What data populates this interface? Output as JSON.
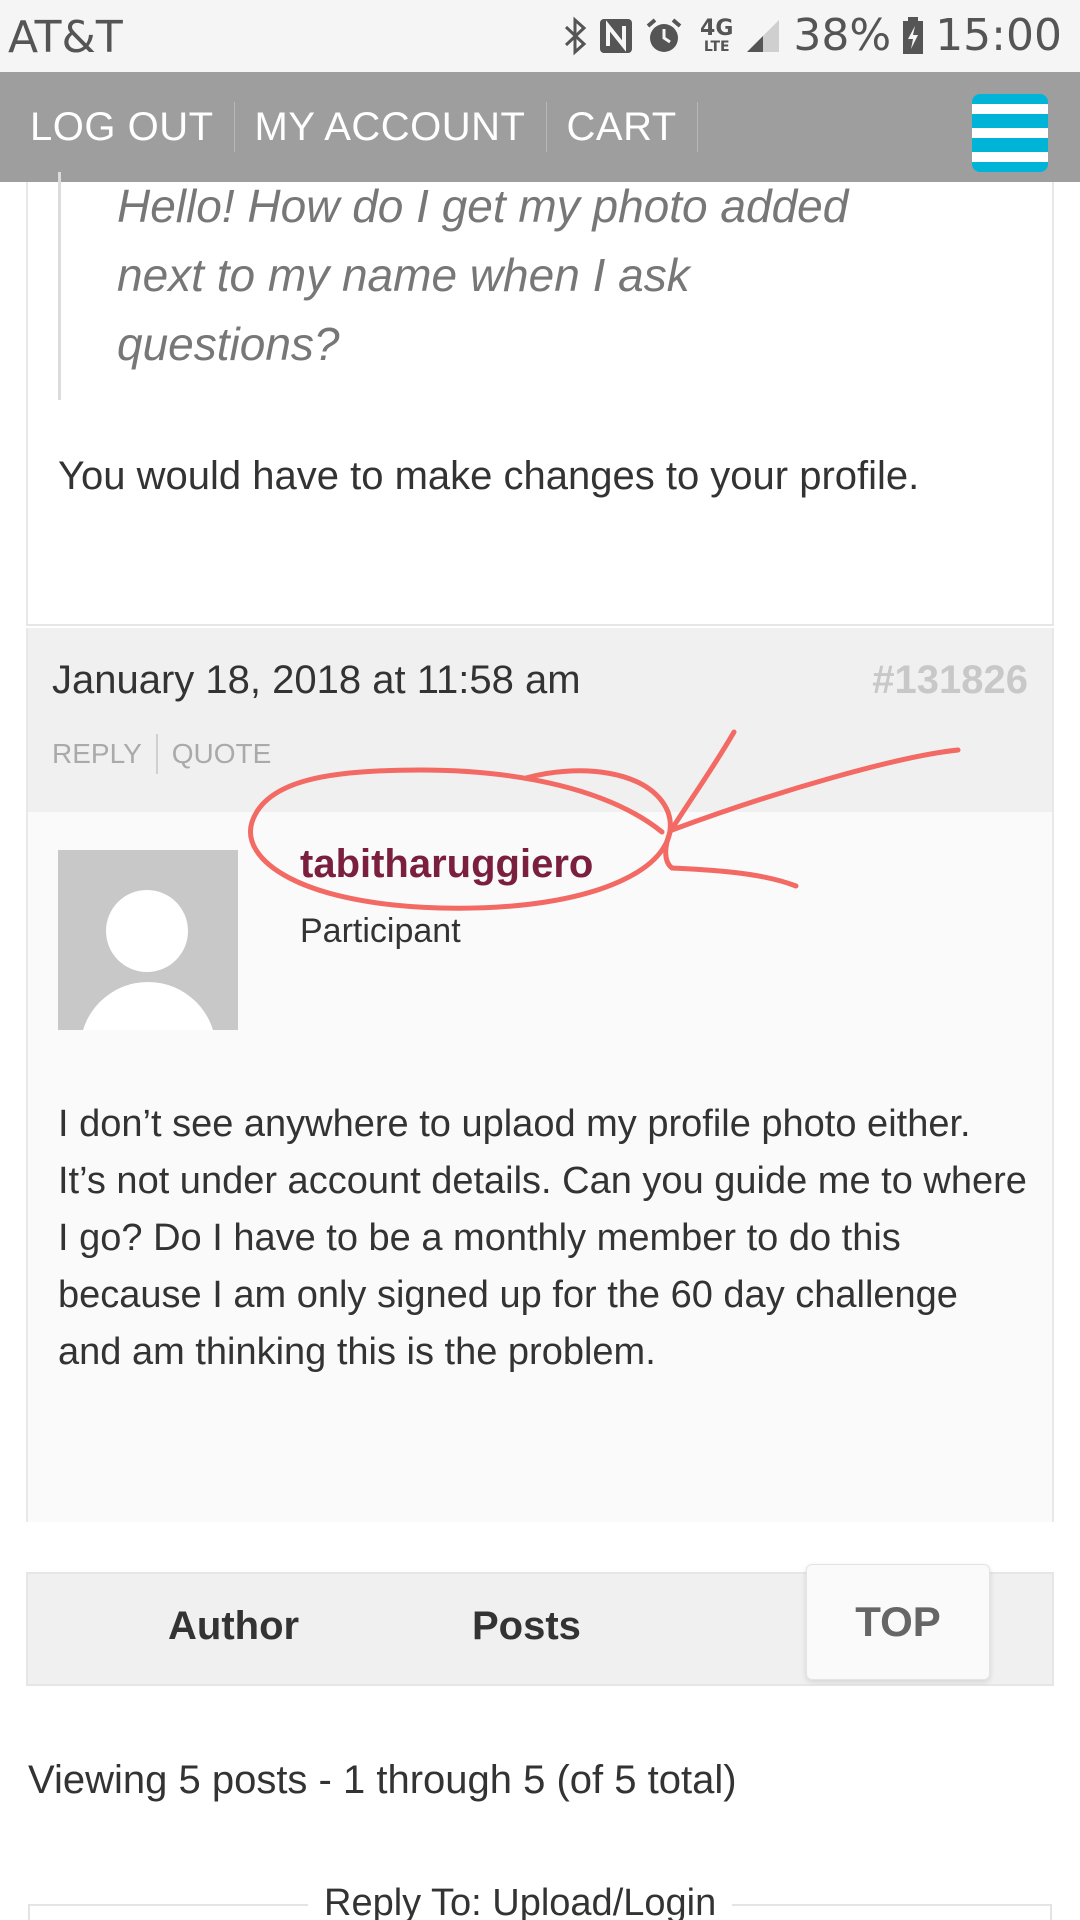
{
  "status_bar": {
    "carrier": "AT&T",
    "network": "4G",
    "network_sub": "LTE",
    "battery": "38%",
    "time": "15:00",
    "icons": [
      "bluetooth-icon",
      "nfc-icon",
      "alarm-icon",
      "signal-icon",
      "battery-charging-icon"
    ]
  },
  "nav": {
    "links": [
      "LOG OUT",
      "MY ACCOUNT",
      "CART"
    ],
    "menu_icon": "hamburger-menu-icon",
    "accent_color": "#00b4d8"
  },
  "quote": {
    "lines": [
      "Hello! How do I get my photo added",
      "next to my name when I ask",
      "questions?"
    ]
  },
  "prior_reply": "You would have to make changes to your profile.",
  "post": {
    "date": "January 18, 2018 at 11:58 am",
    "id": "#131826",
    "actions": [
      "REPLY",
      "QUOTE"
    ],
    "author": "tabitharuggiero",
    "author_color": "#7a1f3d",
    "role": "Participant",
    "content": "I don’t see anywhere to uplaod my profile photo either. It’s not under account details. Can you guide me to where I go? Do I have to be a monthly member to do this because I am only signed up for the 60 day challenge and am thinking this is the problem.",
    "annotation_color": "#f26a63"
  },
  "table_footer": {
    "author_label": "Author",
    "posts_label": "Posts"
  },
  "top_button": "TOP",
  "pagination": "Viewing 5 posts - 1 through 5 (of 5 total)",
  "reply_form_title": "Reply To: Upload/Login"
}
